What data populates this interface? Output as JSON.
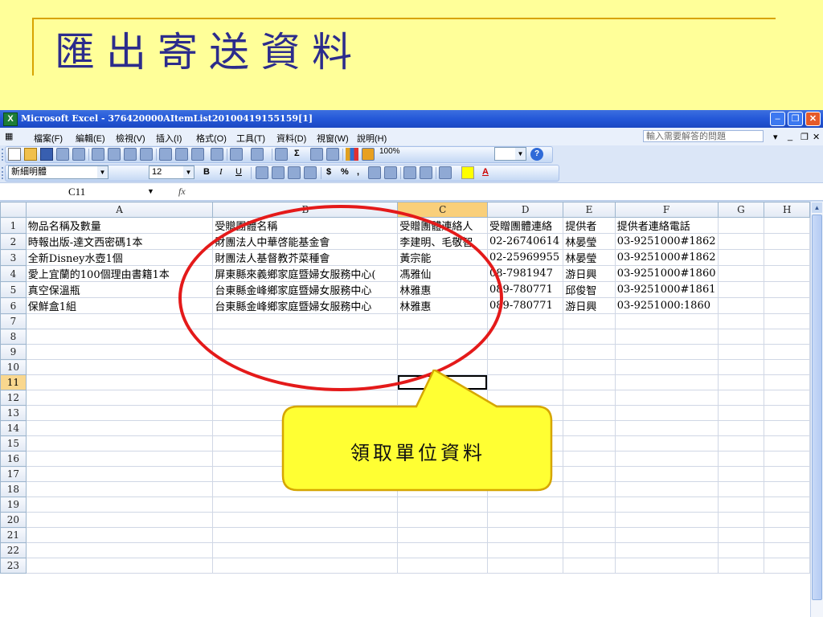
{
  "slide": {
    "title": "匯出寄送資料"
  },
  "window": {
    "title": "Microsoft Excel - 376420000AItemList20100419155159[1]"
  },
  "menu": {
    "items": [
      "檔案(F)",
      "編輯(E)",
      "檢視(V)",
      "插入(I)",
      "格式(O)",
      "工具(T)",
      "資料(D)",
      "視窗(W)",
      "說明(H)"
    ],
    "help_placeholder": "輸入需要解答的問題"
  },
  "toolbar": {
    "zoom": "100%"
  },
  "format_toolbar": {
    "font": "新細明體",
    "size": "12",
    "bold": "B",
    "italic": "I",
    "underline": "U",
    "currency": "$",
    "percent": "%",
    "comma": ","
  },
  "formula_bar": {
    "cell_ref": "C11",
    "fx": "fx"
  },
  "sheet": {
    "columns": [
      "A",
      "B",
      "C",
      "D",
      "E",
      "F",
      "G",
      "H"
    ],
    "selected_row": 11,
    "selected_column": "C",
    "rows": [
      [
        "物品名稱及數量",
        "受贈團體名稱",
        "受贈團體連絡人",
        "受贈團體連絡",
        "提供者",
        "提供者連絡電話",
        "",
        ""
      ],
      [
        "時報出版-達文西密碼1本",
        "財團法人中華啓能基金會",
        "李建明、毛敬智",
        "02-26740614",
        "林晏瑩",
        "03-9251000#1862",
        "",
        ""
      ],
      [
        "全新Disney水壺1個",
        "財團法人基督教芥菜種會",
        "黃宗能",
        "02-25969955",
        "林晏瑩",
        "03-9251000#1862",
        "",
        ""
      ],
      [
        "愛上宜蘭的100個理由書籍1本",
        "屏東縣來義鄉家庭暨婦女服務中心(",
        "馮雅仙",
        "08-7981947",
        "游日興",
        "03-9251000#1860",
        "",
        ""
      ],
      [
        "真空保溫瓶",
        "台東縣金峰鄉家庭暨婦女服務中心",
        "林雅惠",
        "089-780771",
        "邱俊智",
        "03-9251000#1861",
        "",
        ""
      ],
      [
        "保鮮盒1組",
        "台東縣金峰鄉家庭暨婦女服務中心",
        "林雅惠",
        "089-780771",
        "游日興",
        "03-9251000:1860",
        "",
        ""
      ]
    ],
    "total_rows": 23
  },
  "annotation": {
    "callout_text": "領取單位資料"
  },
  "colors": {
    "slide_bg": "#ffff99",
    "title": "#2c2c8c",
    "ellipse": "#e41a1a",
    "callout_fill": "#ffff33",
    "callout_stroke": "#d6a600"
  }
}
